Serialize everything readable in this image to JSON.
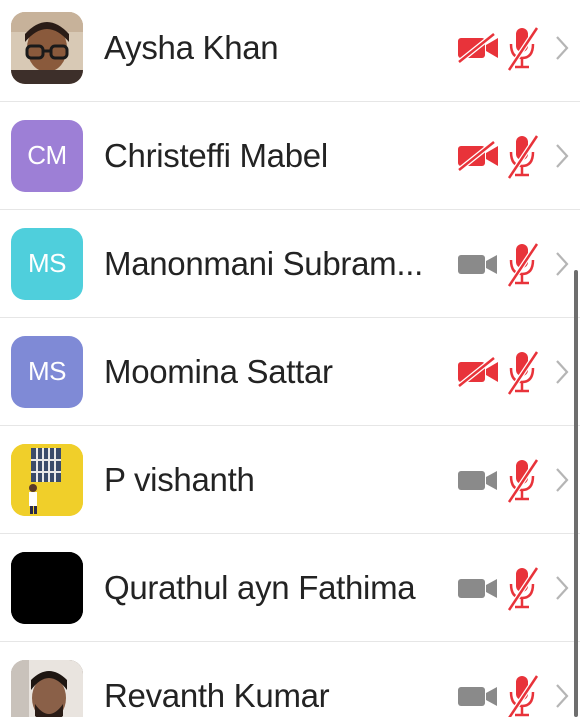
{
  "participants": [
    {
      "name": "Aysha Khan",
      "avatar": {
        "type": "photo",
        "photo": "woman-with-glasses",
        "bg": "#b9a58f"
      },
      "video": "off",
      "audio": "muted"
    },
    {
      "name": "Christeffi Mabel",
      "avatar": {
        "type": "initials",
        "initials": "CM",
        "bg": "#9d7fd6"
      },
      "video": "off",
      "audio": "muted"
    },
    {
      "name": "Manonmani Subram...",
      "avatar": {
        "type": "initials",
        "initials": "MS",
        "bg": "#4fcfdc"
      },
      "video": "on",
      "audio": "muted"
    },
    {
      "name": "Moomina Sattar",
      "avatar": {
        "type": "initials",
        "initials": "MS",
        "bg": "#7f8ad6"
      },
      "video": "off",
      "audio": "muted"
    },
    {
      "name": "P vishanth",
      "avatar": {
        "type": "photo",
        "photo": "man-by-yellow-wall",
        "bg": "#f0cf2a"
      },
      "video": "on",
      "audio": "muted"
    },
    {
      "name": "Qurathul ayn Fathima",
      "avatar": {
        "type": "photo",
        "photo": "black-square",
        "bg": "#000000"
      },
      "video": "on",
      "audio": "muted"
    },
    {
      "name": "Revanth Kumar",
      "avatar": {
        "type": "photo",
        "photo": "young-man",
        "bg": "#6a5a4c"
      },
      "video": "on",
      "audio": "muted"
    }
  ],
  "colors": {
    "muted_red": "#e8333a",
    "video_on_gray": "#8a8a8a",
    "chevron": "#b5b5b5",
    "text": "#232323"
  },
  "icons": {
    "video_off": "video-off-icon",
    "video_on": "video-camera-icon",
    "audio_muted": "microphone-muted-icon",
    "more": "chevron-right-icon"
  }
}
